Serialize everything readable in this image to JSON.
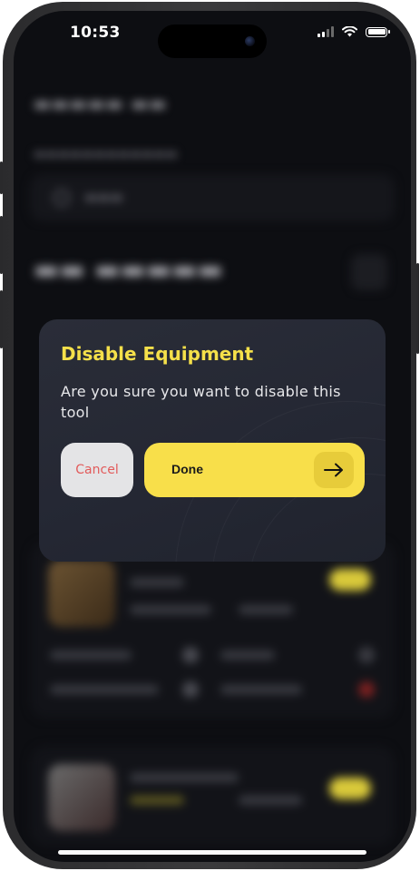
{
  "status_bar": {
    "time": "10:53",
    "icons": [
      "cellular-signal-icon",
      "wifi-icon",
      "battery-icon"
    ]
  },
  "dialog": {
    "title": "Disable Equipment",
    "message": "Are you sure you want to disable this tool",
    "cancel_label": "Cancel",
    "done_label": "Done",
    "done_icon": "arrow-right-icon"
  },
  "colors": {
    "accent_yellow": "#F8DF4A",
    "cancel_text_red": "#E25B5B",
    "dialog_background": "#262935",
    "screen_background": "#0D0E12"
  }
}
